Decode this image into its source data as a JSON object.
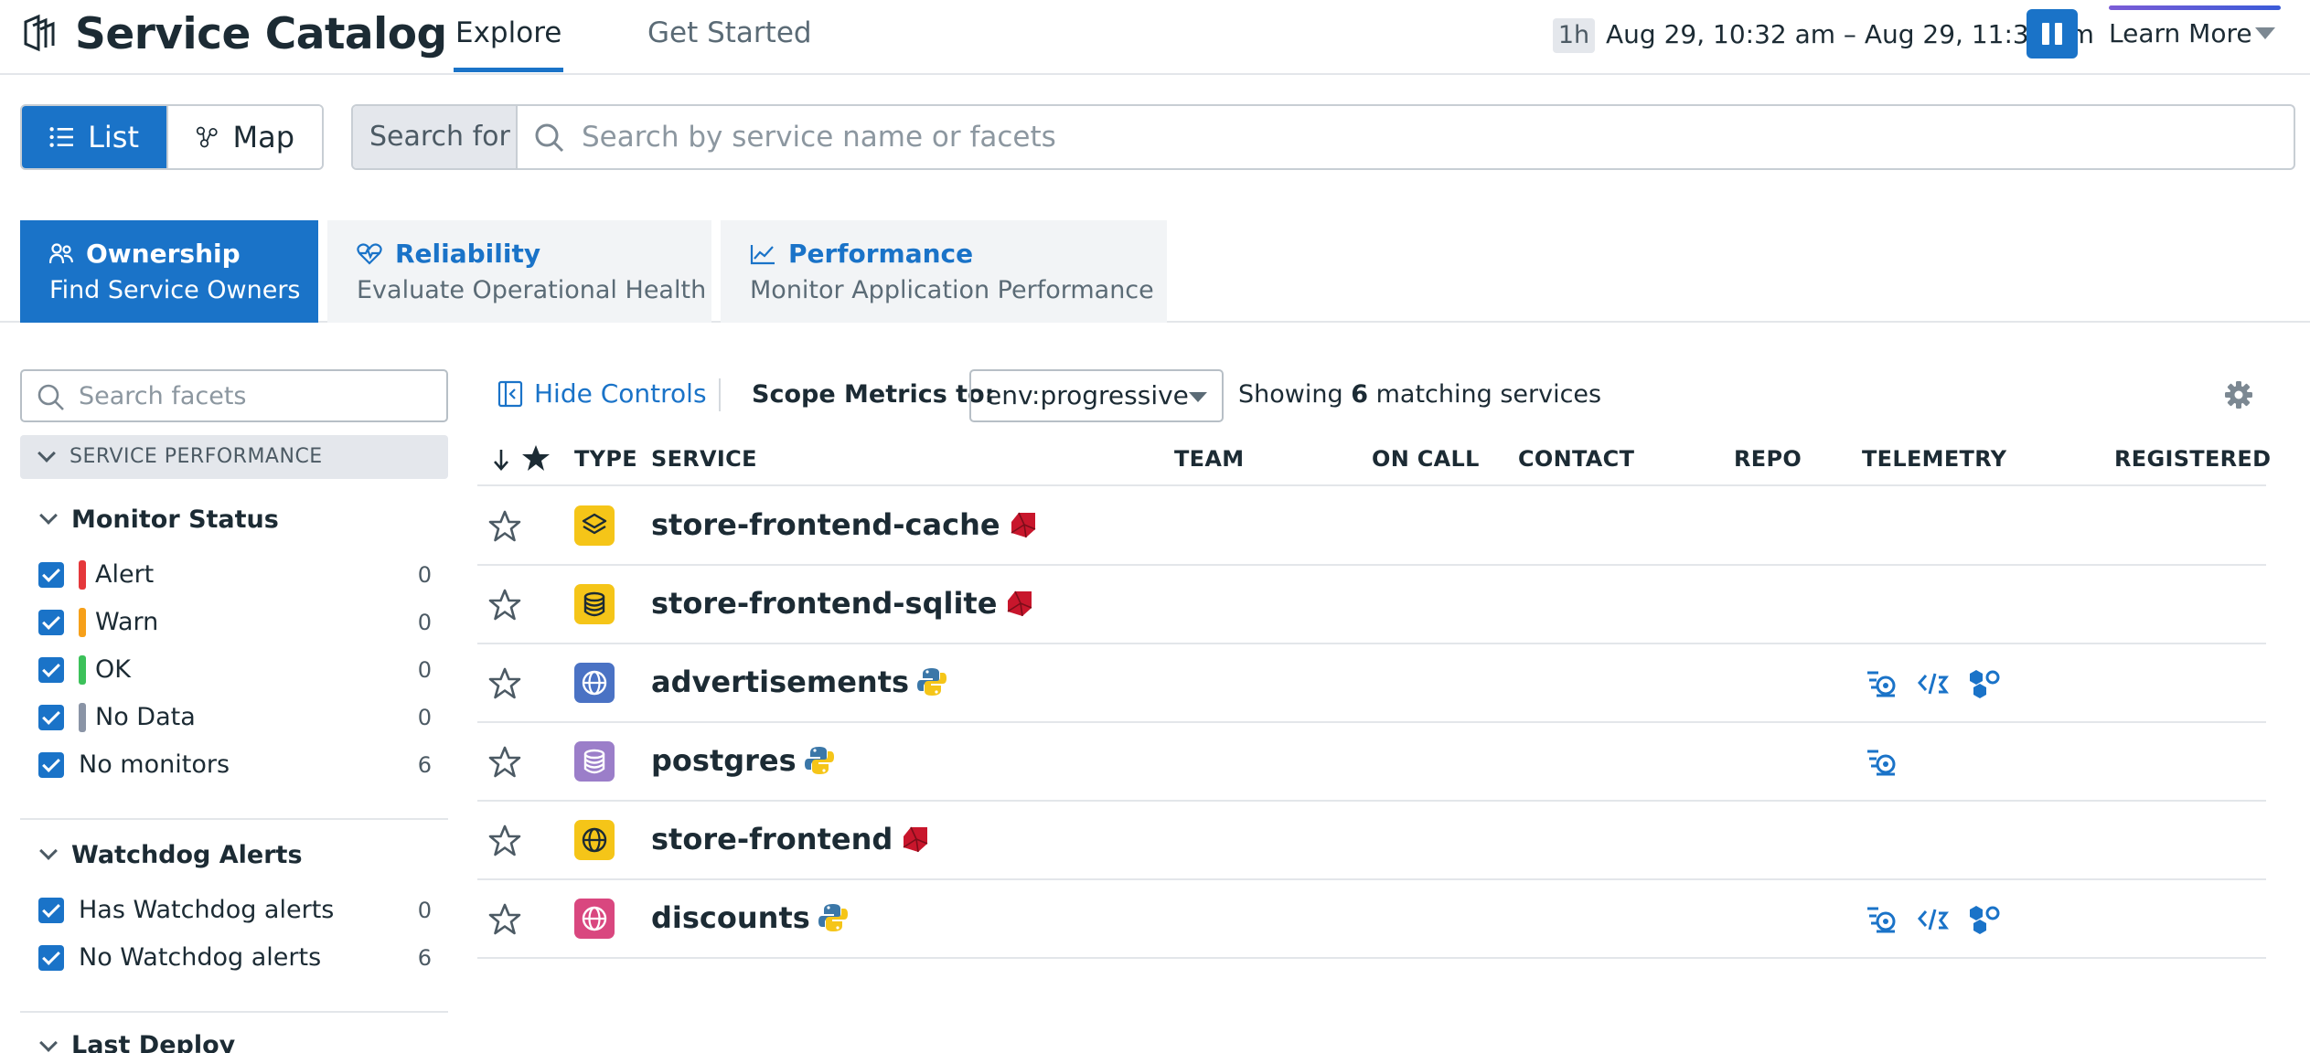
{
  "header": {
    "title": "Service Catalog",
    "tabs": [
      {
        "label": "Explore",
        "active": true
      },
      {
        "label": "Get Started",
        "active": false
      }
    ],
    "time_badge": "1h",
    "time_range": "Aug 29, 10:32 am – Aug 29, 11:32 am",
    "learn_more": "Learn More"
  },
  "toolbar": {
    "view_list": "List",
    "view_map": "Map",
    "search_prefix": "Search for",
    "search_placeholder": "Search by service name or facets"
  },
  "categories": [
    {
      "name": "Ownership",
      "desc": "Find Service Owners",
      "icon": "people-icon",
      "active": true
    },
    {
      "name": "Reliability",
      "desc": "Evaluate Operational Health",
      "icon": "heartbeat-icon",
      "active": false
    },
    {
      "name": "Performance",
      "desc": "Monitor Application Performance",
      "icon": "line-chart-icon",
      "active": false
    }
  ],
  "facets": {
    "search_placeholder": "Search facets",
    "section": "SERVICE PERFORMANCE",
    "monitor_status": {
      "title": "Monitor Status",
      "items": [
        {
          "label": "Alert",
          "count": "0",
          "color": "#e5383b"
        },
        {
          "label": "Warn",
          "count": "0",
          "color": "#f6a01a"
        },
        {
          "label": "OK",
          "count": "0",
          "color": "#3cc15a"
        },
        {
          "label": "No Data",
          "count": "0",
          "color": "#8a94a6"
        },
        {
          "label": "No monitors",
          "count": "6"
        }
      ]
    },
    "watchdog": {
      "title": "Watchdog Alerts",
      "items": [
        {
          "label": "Has Watchdog alerts",
          "count": "0"
        },
        {
          "label": "No Watchdog alerts",
          "count": "6"
        }
      ]
    },
    "last_deploy": {
      "title": "Last Deploy"
    }
  },
  "controls": {
    "hide_controls": "Hide Controls",
    "scope_label": "Scope Metrics to:",
    "scope_value": "env:progressive",
    "showing_prefix": "Showing",
    "showing_count": "6",
    "showing_suffix": "matching services"
  },
  "table": {
    "columns": [
      "TYPE",
      "SERVICE",
      "TEAM",
      "ON CALL",
      "CONTACT",
      "REPO",
      "TELEMETRY",
      "REGISTERED"
    ],
    "rows": [
      {
        "name": "store-frontend-cache",
        "type_icon": "cache-icon",
        "type_color": "#f5c518",
        "lang": "ruby",
        "telemetry": []
      },
      {
        "name": "store-frontend-sqlite",
        "type_icon": "database-icon",
        "type_color": "#f5c518",
        "lang": "ruby",
        "telemetry": []
      },
      {
        "name": "advertisements",
        "type_icon": "globe-icon",
        "type_color": "#4a72c4",
        "lang": "python",
        "telemetry": [
          "apm",
          "profiler",
          "infra"
        ]
      },
      {
        "name": "postgres",
        "type_icon": "database-icon",
        "type_color": "#9b7ec9",
        "lang": "python",
        "telemetry": [
          "apm"
        ]
      },
      {
        "name": "store-frontend",
        "type_icon": "globe-icon",
        "type_color": "#f5c518",
        "lang": "ruby",
        "telemetry": []
      },
      {
        "name": "discounts",
        "type_icon": "globe-icon",
        "type_color": "#d9477f",
        "lang": "python",
        "telemetry": [
          "apm",
          "profiler",
          "infra"
        ]
      }
    ]
  }
}
